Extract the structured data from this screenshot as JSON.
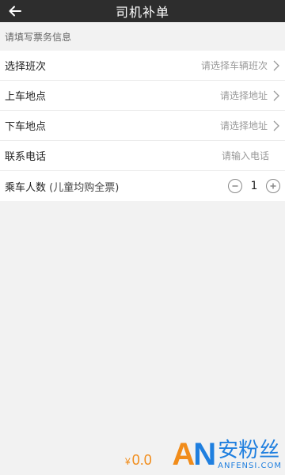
{
  "header": {
    "title": "司机补单"
  },
  "section_hint": "请填写票务信息",
  "form": {
    "rows": [
      {
        "label": "选择班次",
        "placeholder": "请选择车辆班次"
      },
      {
        "label": "上车地点",
        "placeholder": "请选择地址"
      },
      {
        "label": "下车地点",
        "placeholder": "请选择地址"
      },
      {
        "label": "联系电话",
        "placeholder": "请输入电话"
      }
    ],
    "passengers": {
      "label": "乘车人数",
      "note": " (儿童均购全票)",
      "quantity": "1"
    }
  },
  "bottom": {
    "currency": "¥",
    "amount": "0.0"
  },
  "watermark": {
    "logo_a": "A",
    "logo_n": "N",
    "cn_text": "安粉丝",
    "en_text": "ANFENSI.COM"
  },
  "colors": {
    "header_bg": "#2d2d2d",
    "accent_orange": "#f18c1a",
    "watermark_blue": "#1f7fdf"
  },
  "icons": {
    "back": "arrow-left-icon",
    "chevron": "chevron-right-icon",
    "minus": "minus-circle-icon",
    "plus": "plus-circle-icon"
  }
}
